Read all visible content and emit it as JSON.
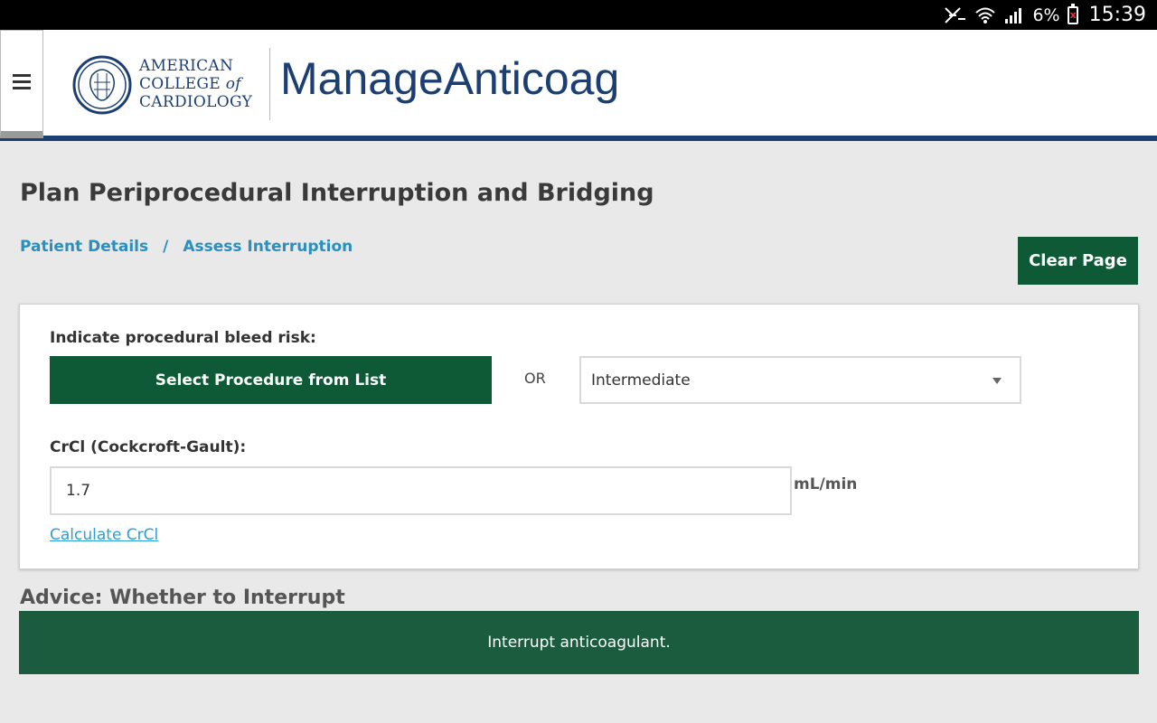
{
  "status_bar": {
    "battery_pct": "6%",
    "time": "15:39",
    "icons": [
      "mute-icon",
      "wifi-icon",
      "signal-icon",
      "battery-icon"
    ]
  },
  "header": {
    "org_line1": "AMERICAN",
    "org_line2a": "COLLEGE",
    "org_line2b": "of",
    "org_line3": "CARDIOLOGY",
    "app_title": "ManageAnticoag",
    "menu_icon": "hamburger-menu-icon"
  },
  "page": {
    "title": "Plan Periprocedural Interruption and Bridging",
    "breadcrumb": {
      "item1": "Patient Details",
      "separator": "/",
      "item2": "Assess Interruption"
    },
    "clear_button": "Clear Page"
  },
  "form": {
    "bleed_risk_label": "Indicate procedural bleed risk:",
    "select_procedure_button": "Select Procedure from List",
    "or_text": "OR",
    "bleed_risk_value": "Intermediate",
    "crcl_label": "CrCl (Cockcroft-Gault):",
    "crcl_value": "1.7",
    "crcl_unit": "mL/min",
    "calculate_link": "Calculate CrCl"
  },
  "advice": {
    "heading": "Advice: Whether to Interrupt",
    "text": "Interrupt anticoagulant."
  },
  "colors": {
    "brand_navy": "#1c3f73",
    "button_green": "#0e5a37",
    "link_blue": "#2a8fbd"
  }
}
